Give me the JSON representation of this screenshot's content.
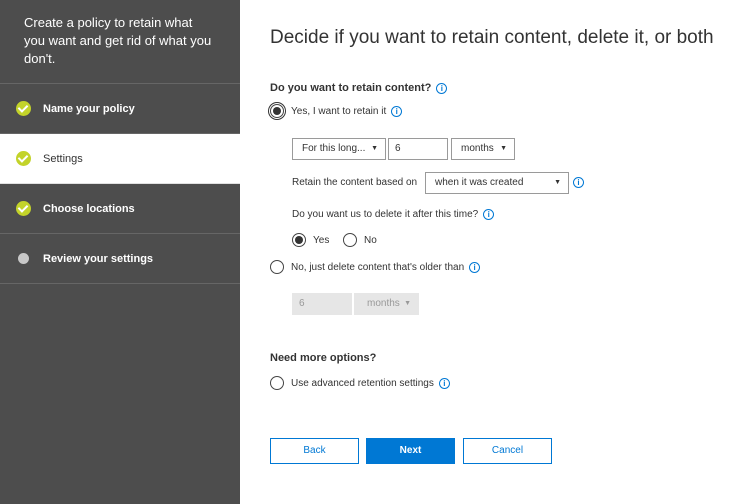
{
  "sidebar": {
    "header": "Create a policy to retain what you want and get rid of what you don't.",
    "steps": [
      {
        "label": "Name your policy",
        "state": "complete"
      },
      {
        "label": "Settings",
        "state": "active"
      },
      {
        "label": "Choose locations",
        "state": "complete"
      },
      {
        "label": "Review your settings",
        "state": "pending"
      }
    ]
  },
  "main": {
    "title": "Decide if you want to retain content, delete it, or both",
    "retain_question": "Do you want to retain content?",
    "retain_yes_label": "Yes, I want to retain it",
    "duration_select": "For this long...",
    "duration_value": "6",
    "duration_unit": "months",
    "based_on_label": "Retain the content based on",
    "based_on_value": "when it was created",
    "delete_question": "Do you want us to delete it after this time?",
    "delete_yes_label": "Yes",
    "delete_no_label": "No",
    "retain_no_label": "No, just delete content that's older than",
    "older_value": "6",
    "older_unit": "months",
    "more_options_label": "Need more options?",
    "advanced_label": "Use advanced retention settings",
    "info_glyph": "i"
  },
  "buttons": {
    "back": "Back",
    "next": "Next",
    "cancel": "Cancel"
  },
  "colors": {
    "sidebar_bg": "#4d4d4d",
    "check_green": "#c3d32a",
    "accent_blue": "#0078d4"
  }
}
